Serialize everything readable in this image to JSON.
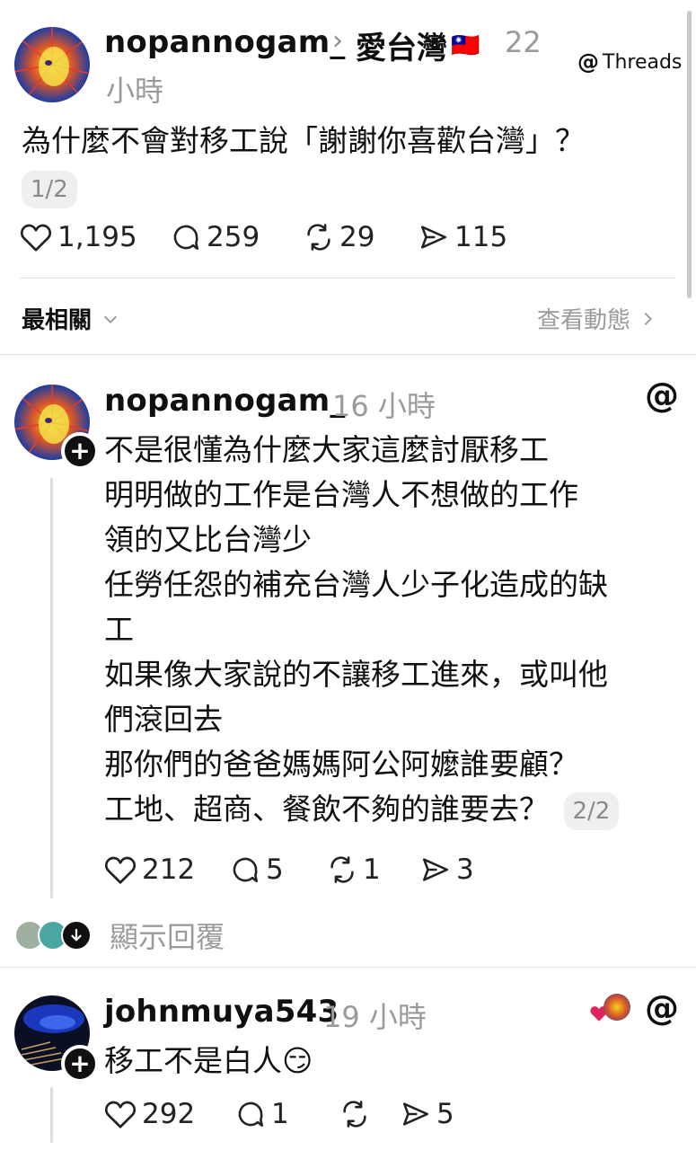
{
  "post": {
    "username": "nopannogam_",
    "topic_arrow": "›",
    "topic": "愛台灣",
    "topic_flag": "🇹🇼",
    "time_line1": "22",
    "time_line2": "小時",
    "brand": "Threads",
    "text": "為什麼不會對移工說「謝謝你喜歡台灣」？",
    "page_indicator": "1/2",
    "likes": "1,195",
    "comments": "259",
    "reposts": "29",
    "shares": "115"
  },
  "sort_bar": {
    "sort_label": "最相關",
    "activity_label": "查看動態"
  },
  "reply1": {
    "username": "nopannogam_",
    "time": "16 小時",
    "lines": [
      "不是很懂為什麼大家這麼討厭移工",
      "明明做的工作是台灣人不想做的工作",
      "領的又比台灣少",
      "任勞任怨的補充台灣人少子化造成的缺",
      "工",
      "如果像大家說的不讓移工進來，或叫他",
      "們滾回去",
      "那你們的爸爸媽媽阿公阿嬤誰要顧？",
      "工地、超商、餐飲不夠的誰要去？"
    ],
    "page_indicator": "2/2",
    "likes": "212",
    "comments": "5",
    "reposts": "1",
    "shares": "3"
  },
  "show_replies": {
    "label": "顯示回覆"
  },
  "reply2": {
    "username": "johnmuya543",
    "time": "19 小時",
    "text": "移工不是白人😏",
    "likes": "292",
    "comments": "1",
    "reposts": "",
    "shares": "5"
  },
  "colors": {
    "text": "#101010",
    "muted": "#9a9a9a",
    "like_heart": "#e0245e",
    "divider": "#e4e4e4"
  }
}
